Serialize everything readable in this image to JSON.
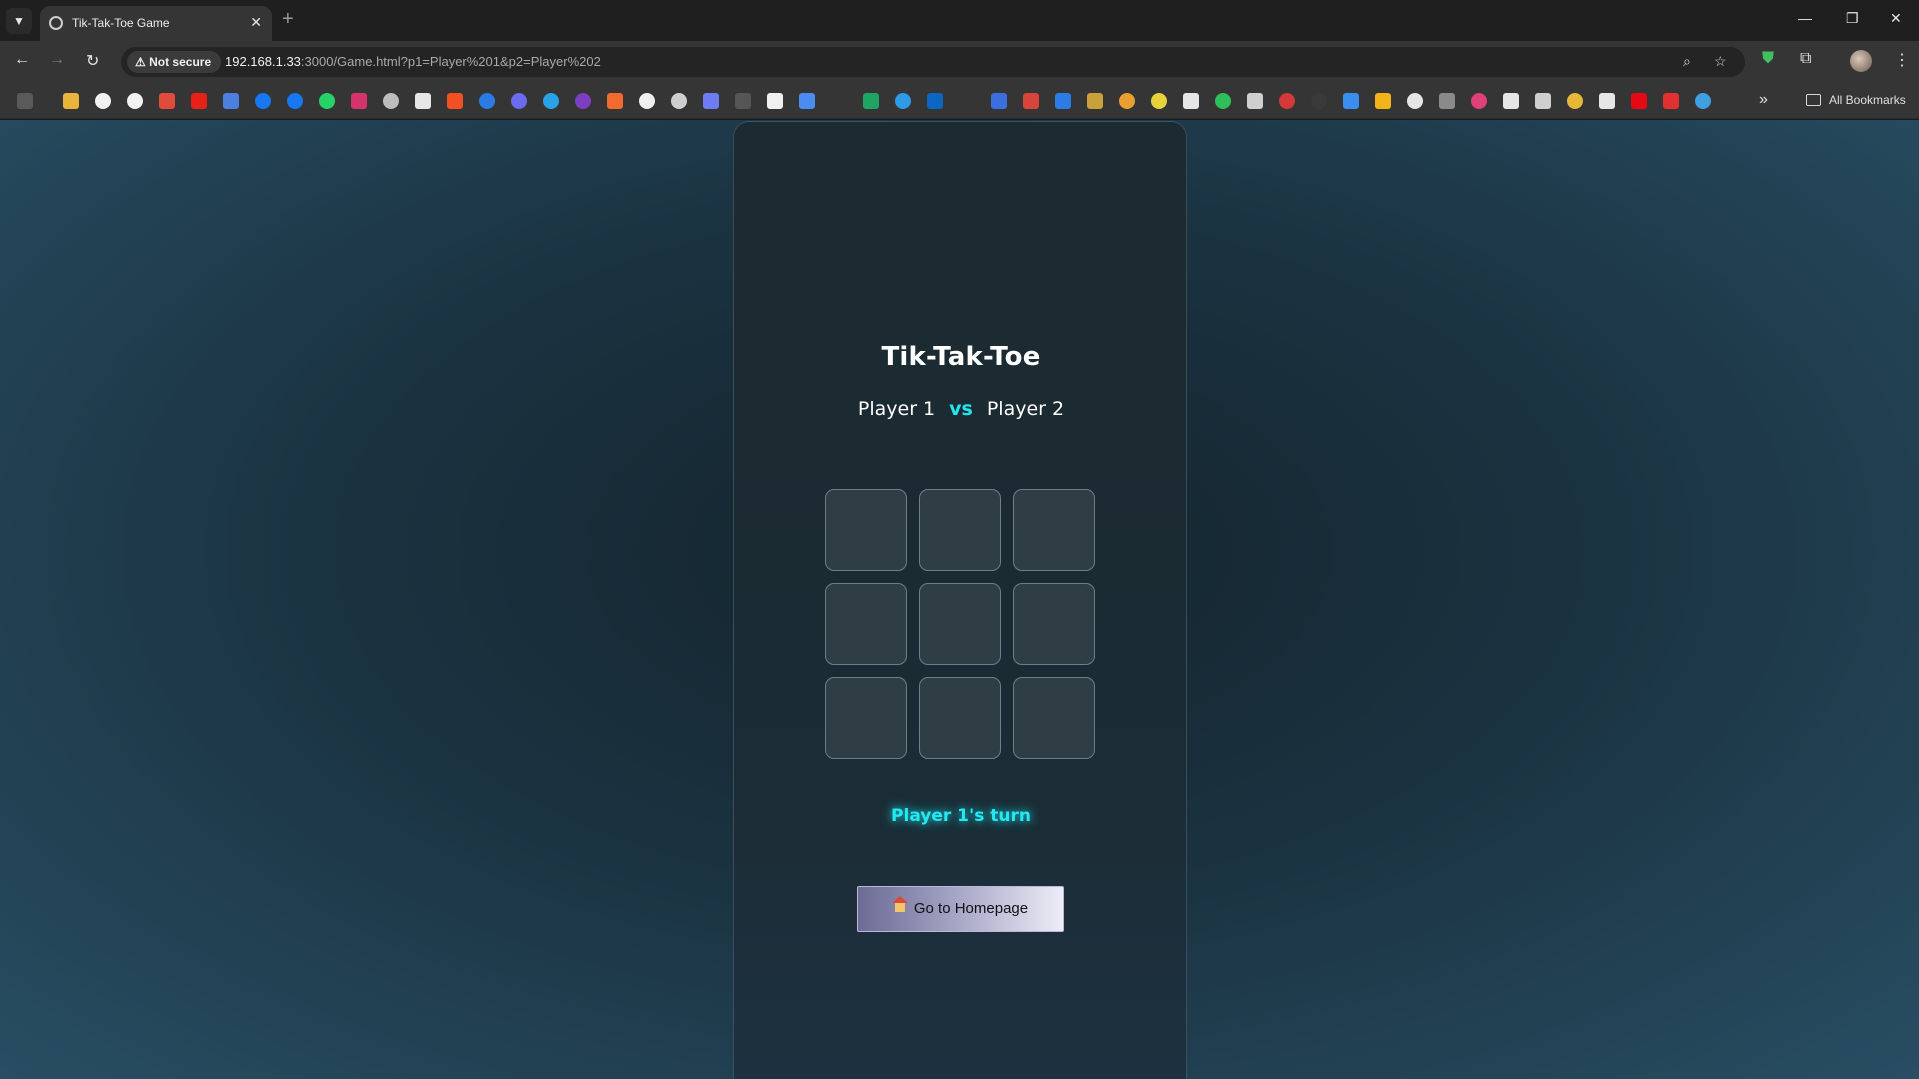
{
  "browser": {
    "tab_title": "Tik-Tak-Toe Game",
    "tab_close": "✕",
    "new_tab": "+",
    "security_label": "Not secure",
    "url_host": "192.168.1.33",
    "url_rest": ":3000/Game.html?p1=Player%201&p2=Player%202",
    "all_bookmarks_label": "All Bookmarks",
    "bookmark_icons": [
      "apps-grid",
      "google",
      "google",
      "gmail",
      "youtube",
      "translate",
      "facebook",
      "facebook",
      "whatsapp",
      "instagram",
      "threads",
      "x",
      "microsoft",
      "canva",
      "messenger",
      "telegram",
      "tor",
      "figma",
      "github",
      "openai",
      "excalidraw",
      "spotify",
      "anthropic",
      "gemini",
      "sheets",
      "copilot",
      "linkedin",
      "meta",
      "canva-dev",
      "paypal",
      "cloud",
      "chrome",
      "lime",
      "pen",
      "hunter",
      "upwork",
      "gauge",
      "dark",
      "blur",
      "windows",
      "grammarly",
      "stack",
      "ico",
      "photoshop",
      "tools",
      "ln",
      "brave",
      "x-red",
      "netflix",
      "pdf",
      "shield"
    ]
  },
  "game": {
    "title": "Tik-Tak-Toe",
    "player1": "Player 1",
    "vs": "vs",
    "player2": "Player 2",
    "board": [
      "",
      "",
      "",
      "",
      "",
      "",
      "",
      "",
      ""
    ],
    "status": "Player 1's turn",
    "home_button": "Go to Homepage"
  },
  "colors": {
    "accent": "#22e6ef",
    "cell_border": "#6c7f89",
    "cell_fill": "#2f3e45"
  }
}
